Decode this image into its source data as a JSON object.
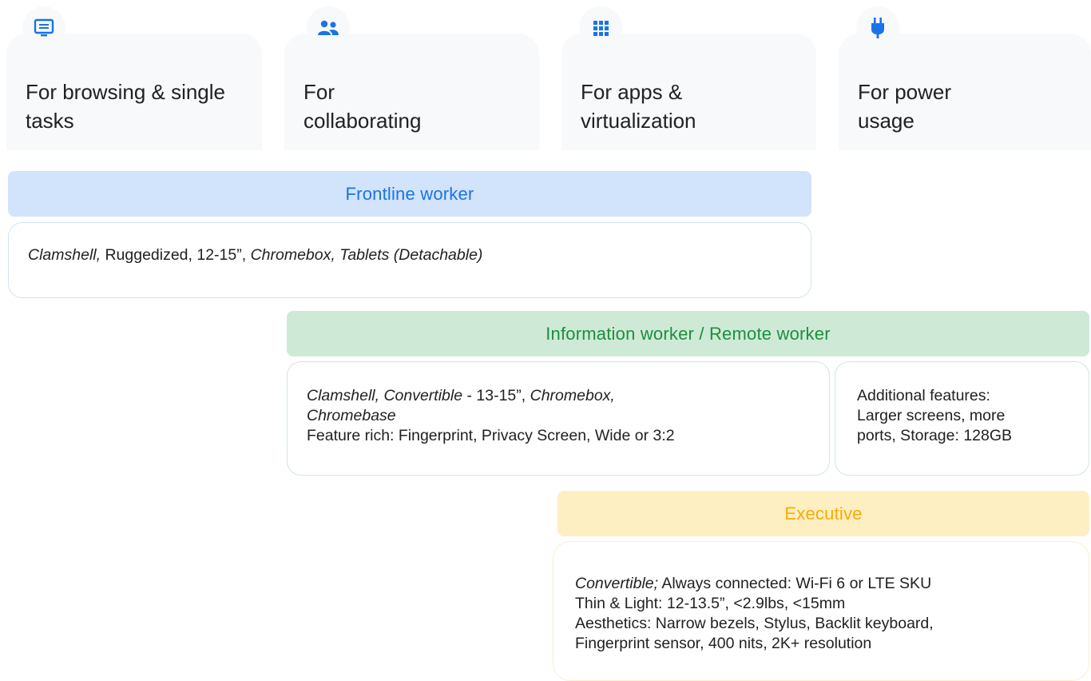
{
  "categories": [
    {
      "label": "For browsing & single tasks",
      "icon": "browser-window-icon"
    },
    {
      "label": "For collaborating",
      "icon": "people-icon"
    },
    {
      "label": "For apps & virtualization",
      "icon": "apps-grid-icon"
    },
    {
      "label": "For power usage",
      "icon": "power-plug-icon"
    }
  ],
  "personas": {
    "frontline": {
      "title": "Frontline worker",
      "desc": {
        "part1": "Clamshell,",
        "part2": " Ruggedized, 12-15”, ",
        "part3": "Chromebox, Tablets (Detachable)"
      }
    },
    "information": {
      "title": "Information worker / Remote worker",
      "desc": {
        "line1_italic": "Clamshell, Convertible",
        "line1_rest": " - 13-15”, ",
        "line1_italic2": "Chromebox,",
        "line2_italic": "Chromebase",
        "line3": "Feature rich: Fingerprint, Privacy Screen, Wide or 3:2"
      },
      "extra": {
        "line1": "Additional features:",
        "line2": "Larger screens, more",
        "line3": "ports, Storage: 128GB"
      }
    },
    "executive": {
      "title": "Executive",
      "desc": {
        "line1_italic": "Convertible;",
        "line1_rest": " Always connected: Wi-Fi 6  or  LTE SKU",
        "line2": "Thin & Light: 12-13.5”, <2.9lbs, <15mm",
        "line3": "Aesthetics: Narrow bezels, Stylus, Backlit keyboard,",
        "line4": "Fingerprint sensor, 400 nits, 2K+  resolution"
      }
    }
  },
  "colors": {
    "icon_blue": "#1a73e8",
    "frontline_band": "#d2e3fc",
    "frontline_text": "#1a73e8",
    "frontline_border": "#d2e3fc",
    "info_band": "#ceead6",
    "info_text": "#1e8e3e",
    "info_border": "#ceead6",
    "exec_band": "#feefc3",
    "exec_text": "#f9ab00",
    "exec_border": "#feefc3"
  }
}
